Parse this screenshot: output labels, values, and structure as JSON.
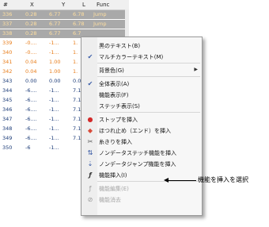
{
  "table": {
    "headers": [
      "#",
      "X",
      "Y",
      "L",
      "Func"
    ],
    "rows": [
      {
        "n": "336",
        "x": "0.28",
        "y": "6.77",
        "l": "6.78",
        "f": "Jump",
        "style": "sel"
      },
      {
        "n": "337",
        "x": "0.28",
        "y": "6.77",
        "l": "6.78",
        "f": "Jump",
        "style": "sel"
      },
      {
        "n": "338",
        "x": "0.28",
        "y": "6.77",
        "l": "6.7",
        "f": "",
        "style": "sel"
      },
      {
        "n": "339",
        "x": "-0....",
        "y": "-1...",
        "l": "1.",
        "f": "",
        "style": "orange"
      },
      {
        "n": "340",
        "x": "-0....",
        "y": "-1...",
        "l": "1.",
        "f": "",
        "style": "orange"
      },
      {
        "n": "341",
        "x": "0.04",
        "y": "1.00",
        "l": "1.",
        "f": "",
        "style": "orange"
      },
      {
        "n": "342",
        "x": "0.04",
        "y": "1.00",
        "l": "1.",
        "f": "",
        "style": "orange"
      },
      {
        "n": "343",
        "x": "0.00",
        "y": "0.00",
        "l": "0.0",
        "f": "",
        "style": "blue"
      },
      {
        "n": "344",
        "x": "-6....",
        "y": "-1...",
        "l": "7.1",
        "f": "",
        "style": "blue"
      },
      {
        "n": "345",
        "x": "-6....",
        "y": "-1...",
        "l": "7.1",
        "f": "",
        "style": "blue"
      },
      {
        "n": "346",
        "x": "-6....",
        "y": "-1...",
        "l": "7.1",
        "f": "",
        "style": "blue"
      },
      {
        "n": "347",
        "x": "-6....",
        "y": "-1...",
        "l": "7.1",
        "f": "",
        "style": "blue"
      },
      {
        "n": "348",
        "x": "-6....",
        "y": "-1...",
        "l": "7.1",
        "f": "",
        "style": "blue"
      },
      {
        "n": "349",
        "x": "-6....",
        "y": "-1...",
        "l": "7.1",
        "f": "",
        "style": "blue"
      },
      {
        "n": "350",
        "x": "-6",
        "y": "-1...",
        "l": "",
        "f": "",
        "style": "blue"
      }
    ]
  },
  "menu": {
    "items": [
      {
        "label": "黒のテキスト(B)",
        "icon": "",
        "checked": false
      },
      {
        "label": "マルチカラーテキスト(M)",
        "icon": "check-icon",
        "checked": true
      },
      {
        "sep": true
      },
      {
        "label": "背景色(G)",
        "icon": "",
        "submenu": true
      },
      {
        "sep": true
      },
      {
        "label": "全体表示(A)",
        "icon": "check-icon",
        "checked": true
      },
      {
        "label": "機能表示(F)",
        "icon": ""
      },
      {
        "label": "ステッチ表示(S)",
        "icon": ""
      },
      {
        "sep": true
      },
      {
        "label": "ストップを挿入",
        "icon": "stop-icon"
      },
      {
        "label": "ほつれ止め（エンド）を挿入",
        "icon": "tie-off-icon"
      },
      {
        "label": "糸きりを挿入",
        "icon": "trim-icon"
      },
      {
        "label": "ノンデータステッチ機能を挿入",
        "icon": "stitch-function-icon"
      },
      {
        "label": "ノンデータジャンプ機能を挿入",
        "icon": "jump-function-icon"
      },
      {
        "label": "機能挿入(I)",
        "icon": "fx-icon"
      },
      {
        "sep": true
      },
      {
        "label": "機能編集(E)",
        "icon": "fx-edit-icon",
        "disabled": true
      },
      {
        "label": "機能消去",
        "icon": "fx-delete-icon",
        "disabled": true
      }
    ]
  },
  "callout": {
    "text": "機能を挿入を選択"
  },
  "colors": {
    "selected_row": "#a9a9a9",
    "orange_text": "#e87d1a",
    "blue_text": "#1c3c78",
    "stop_icon": "#d22a2a"
  }
}
